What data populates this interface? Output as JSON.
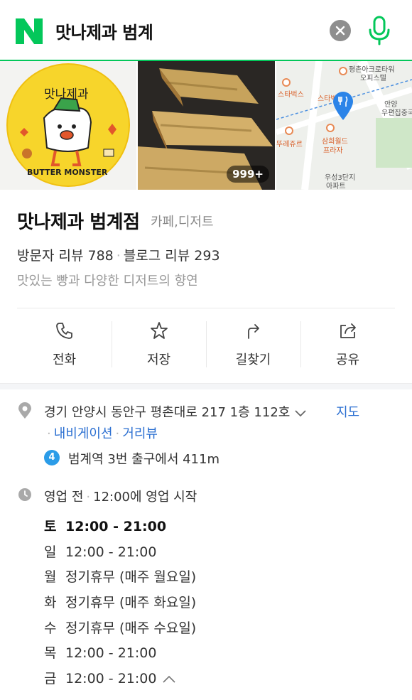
{
  "search": {
    "query": "맛나제과 범계",
    "logo": "naver-n-icon",
    "clear_icon": "close-icon",
    "mic_icon": "microphone-icon",
    "brand_color": "#03c75a"
  },
  "photos": {
    "count_badge": "999+",
    "logo_text_top": "맛나제과",
    "logo_text_bottom": "BUTTER MONSTER",
    "map_labels": [
      "평촌아크로타워",
      "오피스텔",
      "스타벅스",
      "스타벅",
      "안양",
      "우편집중국",
      "뚜레쥬르",
      "삼희월드",
      "프라자",
      "우성3단지",
      "아파트"
    ]
  },
  "place": {
    "name": "맛나제과 범계점",
    "category": "카페,디저트",
    "visitor_reviews": "방문자 리뷰 788",
    "blog_reviews": "블로그 리뷰 293",
    "description": "맛있는 빵과 다양한 디저트의 향연"
  },
  "actions": [
    {
      "label": "전화",
      "icon": "phone-icon"
    },
    {
      "label": "저장",
      "icon": "star-icon"
    },
    {
      "label": "길찾기",
      "icon": "directions-icon"
    },
    {
      "label": "공유",
      "icon": "share-icon"
    }
  ],
  "address": {
    "text": "경기 안양시 동안구 평촌대로 217 1층 112호",
    "map_link": "지도",
    "navigation": "내비게이션",
    "street_view": "거리뷰",
    "subway_line": "4",
    "subway_text": "범계역 3번 출구에서 411m",
    "subway_color": "#2b9ce8"
  },
  "hours": {
    "status": "영업 전",
    "start_text": "12:00에 영업 시작",
    "rows": [
      {
        "day": "토",
        "time": "12:00 - 21:00",
        "today": true
      },
      {
        "day": "일",
        "time": "12:00 - 21:00"
      },
      {
        "day": "월",
        "time": "정기휴무 (매주 월요일)"
      },
      {
        "day": "화",
        "time": "정기휴무 (매주 화요일)"
      },
      {
        "day": "수",
        "time": "정기휴무 (매주 수요일)"
      },
      {
        "day": "목",
        "time": "12:00 - 21:00"
      },
      {
        "day": "금",
        "time": "12:00 - 21:00"
      }
    ]
  }
}
